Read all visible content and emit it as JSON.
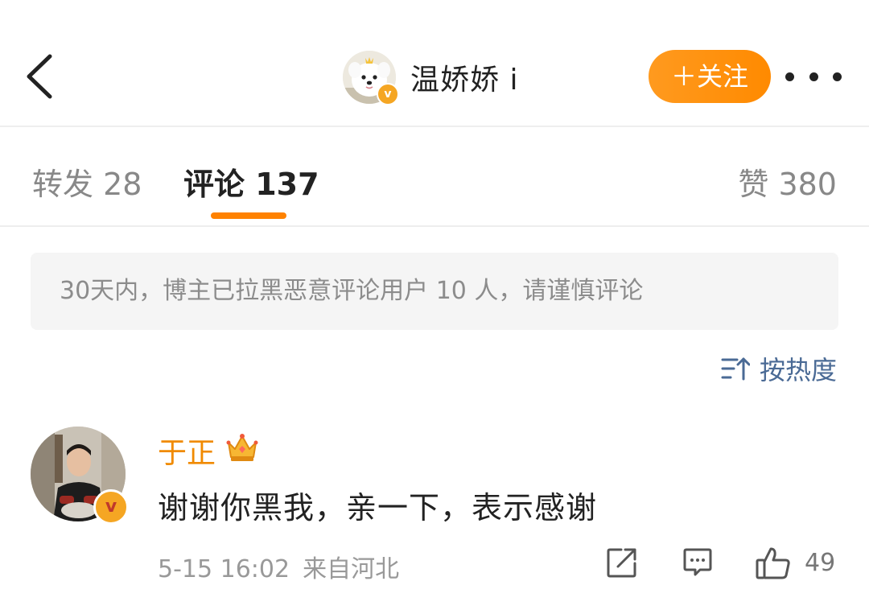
{
  "header": {
    "profile_name": "温娇娇 i",
    "follow_label": "＋关注"
  },
  "tabs": [
    {
      "label": "转发 28",
      "active": false
    },
    {
      "label": "评论 137",
      "active": true
    },
    {
      "label": "赞 380",
      "active": false
    }
  ],
  "notice": {
    "text": "30天内，博主已拉黑恶意评论用户 10 人，请谨慎评论"
  },
  "sort": {
    "label": "按热度"
  },
  "comment": {
    "author": "于正",
    "text": "谢谢你黑我，亲一下，表示感谢",
    "date": "5-15 16:02",
    "location": "来自河北",
    "like_count": "49"
  },
  "colors": {
    "accent": "#ff8200",
    "link_blue": "#4a6a95",
    "verified": "#f5a623",
    "author_name": "#f08a00"
  },
  "icons": [
    "back-icon",
    "verified-icon",
    "more-icon",
    "sort-icon",
    "crown-icon",
    "repost-icon",
    "reply-icon",
    "like-icon"
  ]
}
